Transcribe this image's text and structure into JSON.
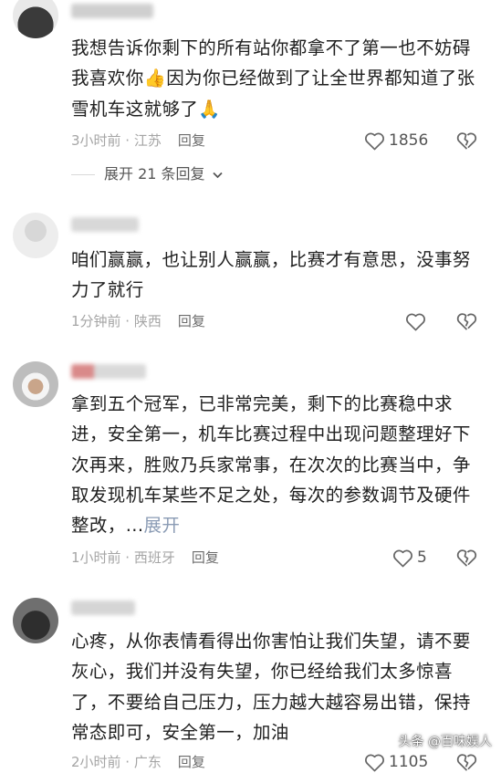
{
  "comments": [
    {
      "text": "我想告诉你剩下的所有站你都拿不了第一也不妨碍我喜欢你👍因为你已经做到了让全世界都知道了张雪机车这就够了🙏",
      "time_location": "3小时前 · 江苏",
      "reply_label": "回复",
      "like_count": "1856",
      "expand_replies": "展开 21 条回复"
    },
    {
      "text": "咱们赢赢，也让别人赢赢，比赛才有意思，没事努力了就行",
      "time_location": "1分钟前 · 陕西",
      "reply_label": "回复",
      "like_count": ""
    },
    {
      "text": "拿到五个冠军，已非常完美，剩下的比赛稳中求进，安全第一，机车比赛过程中出现问题整理好下次再来，胜败乃兵家常事，在次次的比赛当中，争取发现机车某些不足之处，每次的参数调节及硬件整改，...",
      "expand_label": "展开",
      "time_location": "1小时前 · 西班牙",
      "reply_label": "回复",
      "like_count": "5"
    },
    {
      "text": "心疼，从你表情看得出你害怕让我们失望，请不要灰心，我们并没有失望，你已经给我们太多惊喜了，不要给自己压力，压力越大越容易出错，保持常态即可，安全第一，加油",
      "time_location": "2小时前 · 广东",
      "reply_label": "回复",
      "like_count": "1105"
    }
  ],
  "watermark": "头条 @百味娱人",
  "colors": {
    "meta": "#a5a5a5",
    "expand": "#8a9bb4",
    "icon": "#666666"
  },
  "icons": [
    "heart-outline-icon",
    "broken-heart-icon",
    "chevron-down-icon"
  ]
}
